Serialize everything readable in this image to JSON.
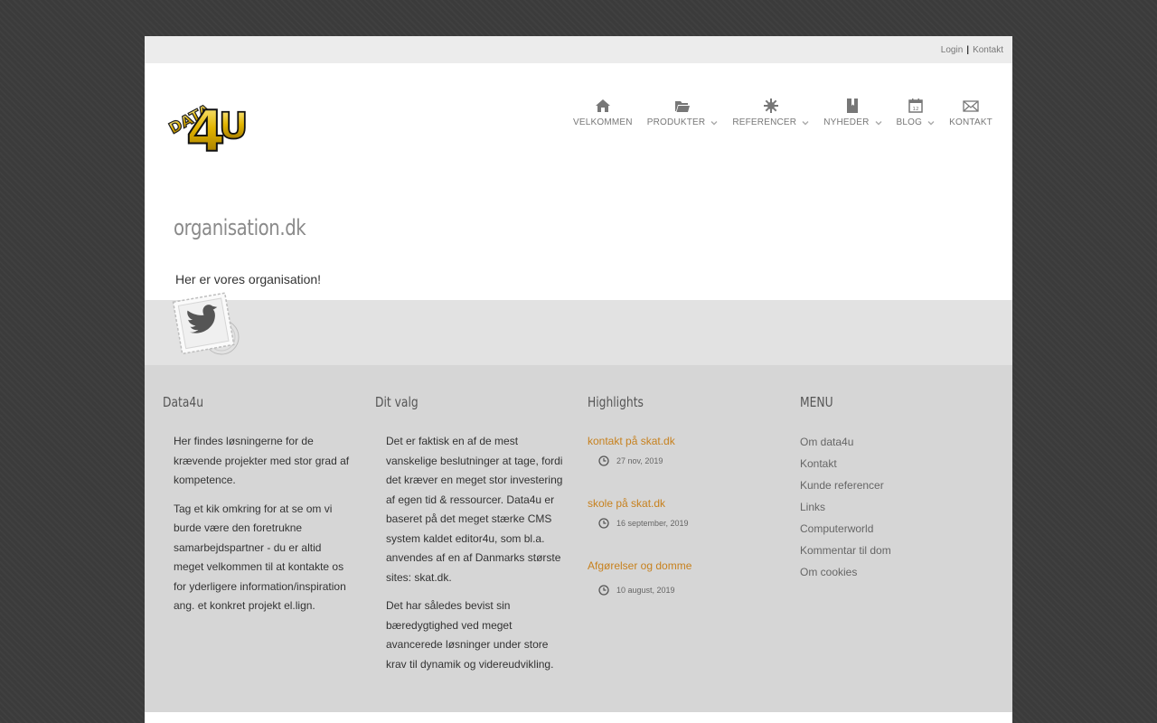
{
  "topbar": {
    "login": "Login",
    "separator": "|",
    "contact": "Kontakt"
  },
  "logo": {
    "text": "DATA4U"
  },
  "nav": [
    {
      "label": "VELKOMMEN",
      "icon": "home-icon",
      "dropdown": false
    },
    {
      "label": "PRODUKTER",
      "icon": "folder-icon",
      "dropdown": true
    },
    {
      "label": "REFERENCER",
      "icon": "asterisk-icon",
      "dropdown": true
    },
    {
      "label": "NYHEDER",
      "icon": "book-icon",
      "dropdown": true
    },
    {
      "label": "BLOG",
      "icon": "calendar-icon",
      "dropdown": true
    },
    {
      "label": "KONTAKT",
      "icon": "envelope-icon",
      "dropdown": false
    }
  ],
  "page": {
    "title": "organisation.dk",
    "intro": "Her er vores organisation!"
  },
  "footer": {
    "col1": {
      "title": "Data4u",
      "p1": "Her findes løsningerne for de krævende projekter med stor grad af kompetence.",
      "p2": "Tag et kik omkring for at se om vi burde være den foretrukne samarbejdspartner - du er altid meget velkommen til at kontakte os for yderligere information/inspiration ang. et konkret projekt el.lign."
    },
    "col2": {
      "title": "Dit valg",
      "p1": "Det er faktisk en af de mest vanskelige beslutninger at tage, fordi det kræver en meget stor investering af egen tid & ressourcer. Data4u er baseret på det meget stærke CMS system kaldet editor4u, som bl.a. anvendes af en af Danmarks største sites: skat.dk.",
      "p2": "Det har således bevist sin bæredygtighed ved meget avancerede løsninger under store krav til dynamik og videreudvikling."
    },
    "col3": {
      "title": "Highlights",
      "items": [
        {
          "title": "kontakt på skat.dk",
          "date": "27 nov, 2019"
        },
        {
          "title": "skole på skat.dk",
          "date": "16 september, 2019"
        },
        {
          "title": "Afgørelser og domme",
          "date": "10 august, 2019"
        }
      ]
    },
    "col4": {
      "title": "MENU",
      "items": [
        "Om data4u",
        "Kontakt",
        "Kunde referencer",
        "Links",
        "Computerworld",
        "Kommentar til dom",
        "Om cookies"
      ]
    }
  },
  "colors": {
    "accent": "#c7811e",
    "background": "#3b3b3b",
    "band": "#e2e2e2",
    "footer": "#d6d6d6"
  }
}
